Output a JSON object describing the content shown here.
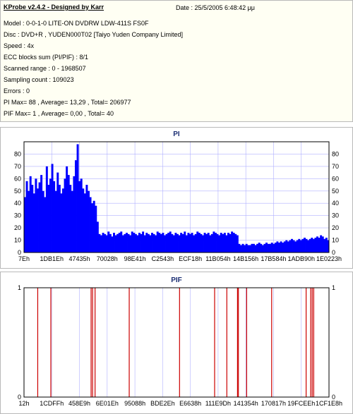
{
  "header": {
    "title": "KProbe v2.4.2 - Designed by Karr",
    "date": "Date : 25/5/2005 6:48:42 μμ",
    "lines": [
      "Model : 0-0-1-0 LITE-ON DVDRW LDW-411S   FS0F",
      "Disc : DVD+R , YUDEN000T02 [Taiyo Yuden Company Limited]",
      "Speed : 4x",
      "ECC blocks sum (PI/PIF) : 8/1",
      "Scanned range : 0 - 1968507",
      "Sampling count : 109023",
      "Errors : 0",
      "PI Max= 88 , Average= 13,29 , Total= 206977",
      "PIF Max= 1 , Average= 0,00 , Total= 40"
    ]
  },
  "chart_data": [
    {
      "type": "bar",
      "title": "PI",
      "ylim": [
        0,
        90
      ],
      "yticks": [
        0,
        10,
        20,
        30,
        40,
        50,
        60,
        70,
        80
      ],
      "xticks": [
        "7Eh",
        "1DB1Eh",
        "47435h",
        "70028h",
        "98E41h",
        "C2543h",
        "ECF18h",
        "11B054h",
        "14B156h",
        "17B584h",
        "1ADB90h",
        "1E0223h"
      ],
      "grid": true,
      "color": "#0000ff",
      "series": [
        {
          "values": [
            45,
            58,
            50,
            62,
            55,
            48,
            60,
            52,
            57,
            63,
            50,
            45,
            70,
            55,
            60,
            72,
            58,
            50,
            65,
            55,
            48,
            52,
            60,
            70,
            63,
            55,
            50,
            62,
            75,
            88,
            58,
            60,
            52,
            48,
            55,
            50,
            45,
            40,
            42,
            38,
            25,
            15,
            14,
            16,
            15,
            14,
            17,
            15,
            13,
            16,
            14,
            15,
            16,
            17,
            14,
            15,
            16,
            15,
            14,
            17,
            16,
            15,
            14,
            16,
            15,
            17,
            14,
            16,
            15,
            14,
            16,
            15,
            14,
            17,
            16,
            15,
            16,
            14,
            15,
            16,
            17,
            15,
            14,
            16,
            15,
            14,
            16,
            15,
            17,
            14,
            16,
            15,
            16,
            14,
            15,
            17,
            16,
            15,
            14,
            16,
            15,
            16,
            14,
            15,
            17,
            16,
            15,
            14,
            16,
            15,
            16,
            14,
            16,
            15,
            17,
            16,
            15,
            14,
            7,
            6,
            7,
            6,
            7,
            6,
            6,
            7,
            7,
            6,
            7,
            8,
            7,
            6,
            7,
            8,
            7,
            7,
            8,
            7,
            8,
            9,
            8,
            9,
            8,
            9,
            10,
            9,
            10,
            11,
            10,
            9,
            10,
            11,
            10,
            11,
            12,
            11,
            10,
            11,
            12,
            11,
            12,
            13,
            12,
            14,
            13,
            11,
            12,
            10
          ]
        }
      ]
    },
    {
      "type": "bar",
      "title": "PIF",
      "ylim": [
        0,
        1
      ],
      "yticks": [
        0,
        1
      ],
      "xticks": [
        "12h",
        "1CDFFh",
        "458E9h",
        "6E01Eh",
        "95088h",
        "BDE2Eh",
        "E6638h",
        "111E9Dh",
        "141354h",
        "170817h",
        "19FCEEh",
        "1CF1E8h"
      ],
      "grid": true,
      "color": "#cc0000",
      "series": [
        {
          "x_fraction": [
            0.045,
            0.088,
            0.22,
            0.225,
            0.233,
            0.345,
            0.51,
            0.625,
            0.665,
            0.7,
            0.703,
            0.73,
            0.812,
            0.925,
            0.94,
            0.945,
            0.95
          ],
          "values": [
            1,
            1,
            1,
            1,
            1,
            1,
            1,
            1,
            1,
            1,
            1,
            1,
            1,
            1,
            1,
            1,
            1
          ]
        }
      ]
    }
  ]
}
